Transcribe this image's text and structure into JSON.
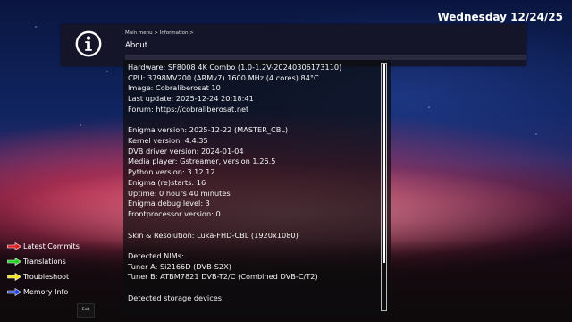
{
  "header": {
    "datetime": "Wednesday 12/24/25"
  },
  "title_bar": {
    "breadcrumb": "Main menu > Information >",
    "title": "About",
    "icon": "info-icon"
  },
  "info": {
    "lines": [
      "Hardware: SF8008 4K Combo (1.0-1.2V-20240306173110)",
      "CPU: 3798MV200 (ARMv7) 1600 MHz (4 cores) 84°C",
      "Image: Cobraliberosat 10",
      "Last update: 2025-12-24 20:18:41",
      "Forum: https://cobraliberosat.net",
      "",
      "Enigma version: 2025-12-22 (MASTER_CBL)",
      "Kernel version: 4.4.35",
      "DVB driver version: 2024-01-04",
      "Media player: Gstreamer, version 1.26.5",
      "Python version: 3.12.12",
      "Enigma (re)starts: 16",
      "Uptime: 0 hours 40 minutes",
      "Enigma debug level: 3",
      "Frontprocessor version: 0",
      "",
      "Skin & Resolution: Luka-FHD-CBL (1920x1080)",
      "",
      "Detected NIMs:",
      "Tuner A: Si2166D (DVB-S2X)",
      "Tuner B: ATBM7821 DVB-T2/C (Combined DVB-C/T2)",
      "",
      "Detected storage devices:"
    ]
  },
  "help_keys": [
    {
      "label": "Latest Commits",
      "color": "#e02020"
    },
    {
      "label": "Translations",
      "color": "#20d020"
    },
    {
      "label": "Troubleshoot",
      "color": "#f0e020"
    },
    {
      "label": "Memory Info",
      "color": "#2040e0"
    }
  ],
  "exit": {
    "label": "Exit"
  }
}
